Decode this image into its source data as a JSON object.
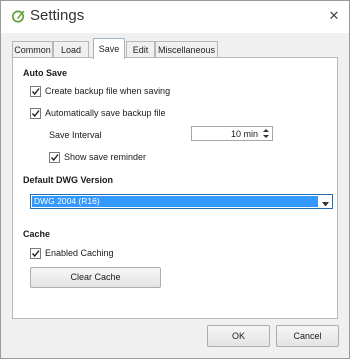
{
  "window": {
    "title": "Settings",
    "close_symbol": "✕"
  },
  "tabs": [
    {
      "label": "Common"
    },
    {
      "label": "Load"
    },
    {
      "label": "Save"
    },
    {
      "label": "Edit"
    },
    {
      "label": "Miscellaneous"
    }
  ],
  "active_tab": "Save",
  "auto_save": {
    "section_label": "Auto Save",
    "create_backup_label": "Create backup file when saving",
    "create_backup_checked": true,
    "auto_save_backup_label": "Automatically save backup file",
    "auto_save_backup_checked": true,
    "interval_label": "Save Interval",
    "interval_value": "10 min",
    "show_reminder_label": "Show save reminder",
    "show_reminder_checked": true
  },
  "dwg": {
    "section_label": "Default DWG Version",
    "selected_value": "DWG 2004 (R16)"
  },
  "cache": {
    "section_label": "Cache",
    "enabled_label": "Enabled Caching",
    "enabled_checked": true,
    "clear_button": "Clear Cache"
  },
  "footer": {
    "ok_label": "OK",
    "cancel_label": "Cancel"
  },
  "colors": {
    "accent_icon": "#5a9e2f",
    "selection": "#3399ff"
  }
}
